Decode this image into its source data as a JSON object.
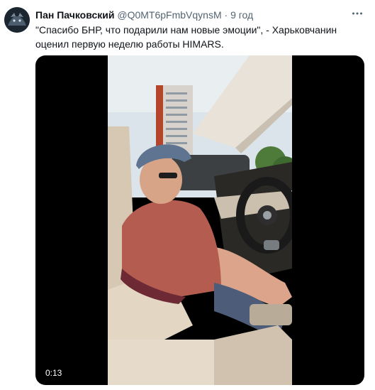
{
  "author": {
    "name": "Пан Пачковский",
    "handle": "@Q0MT6pFmbVqynsM",
    "separator": "·",
    "time": "9 год"
  },
  "tweet": {
    "text": "\"Спасибо БНР, что подарили нам новые эмоции\", - Харьковчанин оценил первую неделю работы HIMARS."
  },
  "media": {
    "duration": "0:13"
  },
  "icons": {
    "more": "more-icon",
    "avatar": "avatar"
  }
}
